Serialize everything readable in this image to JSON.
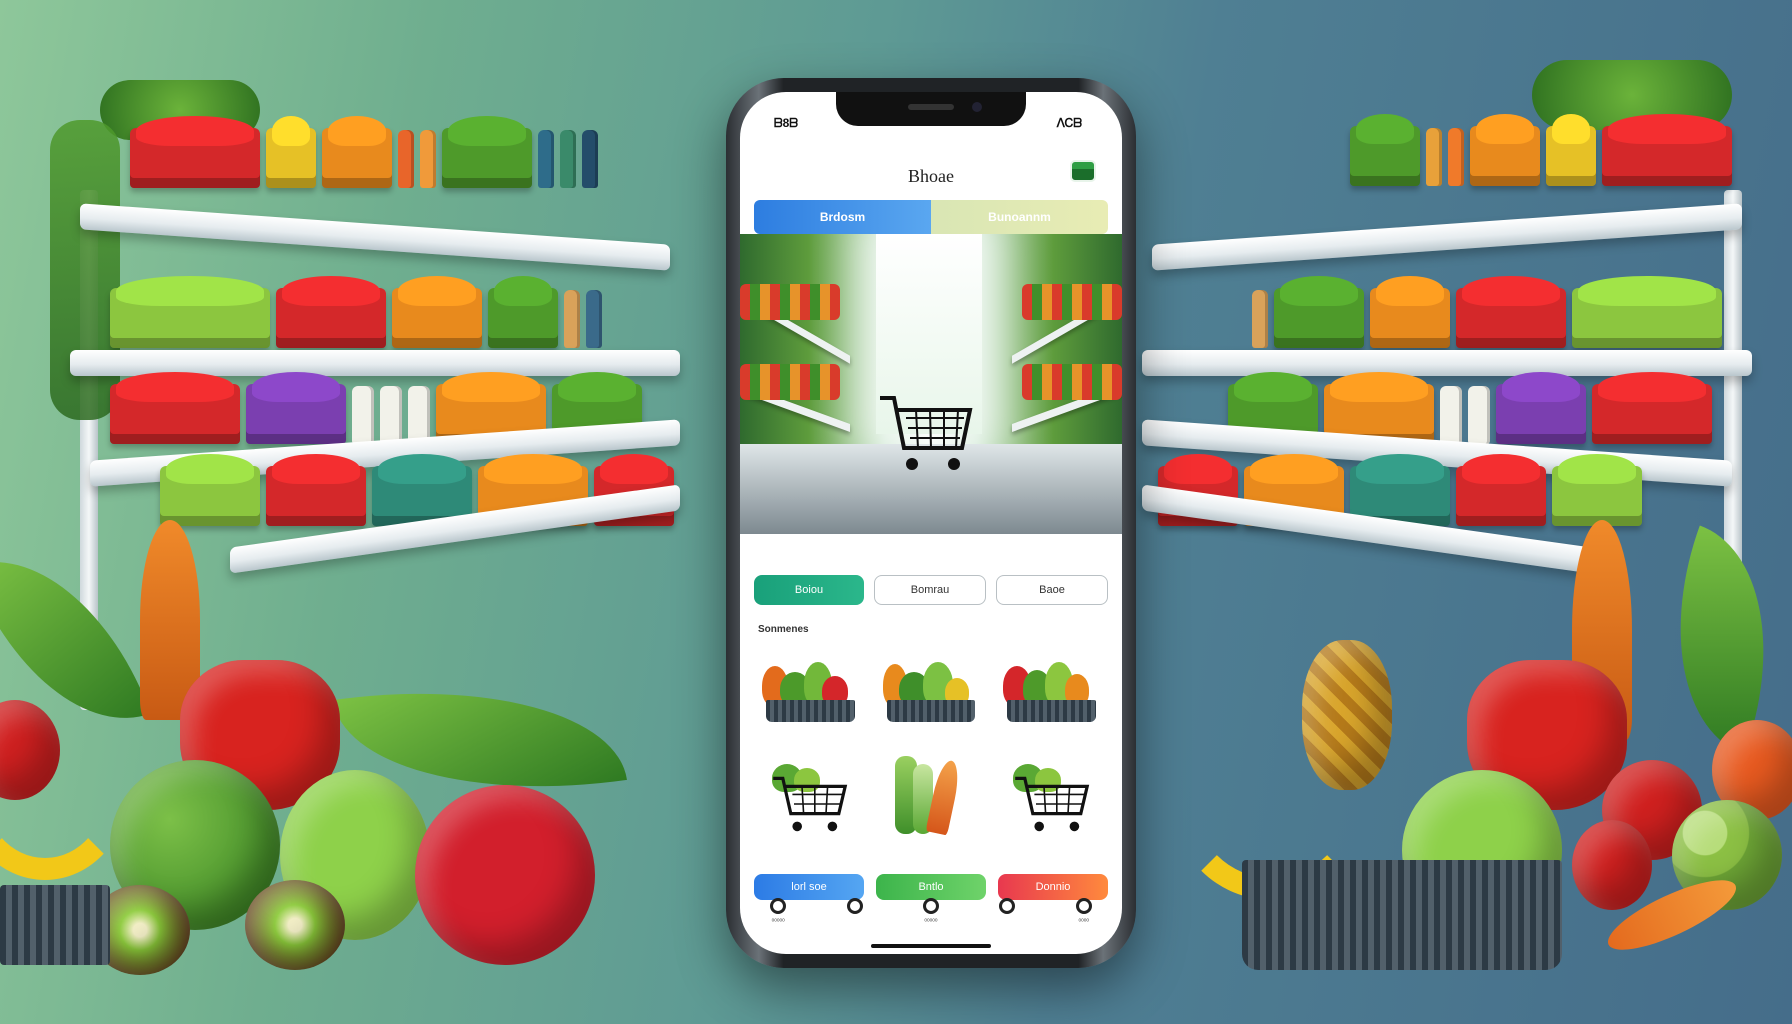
{
  "status_bar": {
    "time": "ᗷ8ᗷ",
    "indicators": "ᐱᏟᗷ"
  },
  "header": {
    "title": "Bhoae",
    "action_icon": "card-icon"
  },
  "segmented": {
    "tabs": [
      "Brdosm",
      "Bunoannm"
    ],
    "active_index": 0
  },
  "hero": {
    "icon": "shopping-cart-icon"
  },
  "filters": {
    "chips": [
      "Boiou",
      "Bomrau",
      "Baoe"
    ],
    "primary_index": 0
  },
  "section": {
    "label": "Sonmenes"
  },
  "products": {
    "row1": [
      "vegetable-basket",
      "vegetable-basket",
      "vegetable-basket"
    ],
    "row2": [
      "shopping-cart-with-greens",
      "vegetable-bundle",
      "shopping-cart-with-greens"
    ]
  },
  "actions": {
    "blue": "lorl soe",
    "green": "Bntlo",
    "red": "Donnio"
  },
  "tabbar": {
    "items": [
      "ᵒᵒᵒᵒᵒ",
      "",
      "ᵒᵒᵒᵒᵒ",
      "",
      "ᵒᵒᵒᵒ"
    ],
    "icons": [
      "home-icon",
      "search-icon",
      "category-icon",
      "cart-icon",
      "profile-icon"
    ]
  },
  "colors": {
    "tab_active": "#2d7de0",
    "chip_primary": "#19a07a",
    "action_blue": "#2c7be5",
    "action_green": "#3cb44b",
    "action_red": "#e8384f"
  }
}
